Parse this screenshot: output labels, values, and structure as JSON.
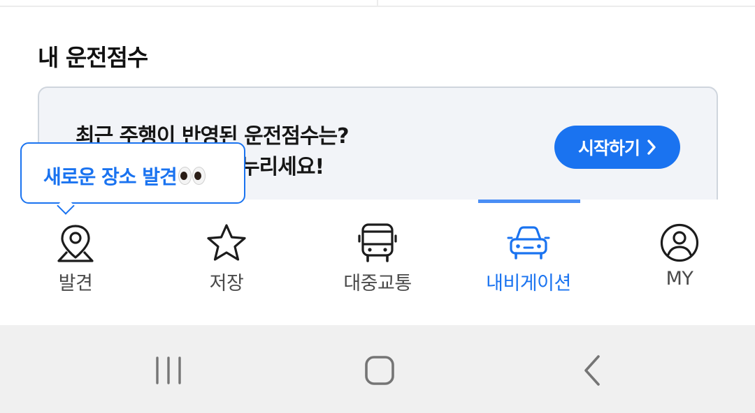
{
  "section": {
    "title": "내 운전점수"
  },
  "score_card": {
    "line1": "최근 주행이 반영된 운전점수는?",
    "line2_prefix": "",
    "line2_suffix": "택 누리세요!",
    "button_label": "시작하기"
  },
  "tooltip": {
    "text": "새로운 장소 발견"
  },
  "tabs": [
    {
      "label": "발견",
      "icon": "map-pin-icon",
      "active": false
    },
    {
      "label": "저장",
      "icon": "star-icon",
      "active": false
    },
    {
      "label": "대중교통",
      "icon": "bus-icon",
      "active": false
    },
    {
      "label": "내비게이션",
      "icon": "car-icon",
      "active": true
    },
    {
      "label": "MY",
      "icon": "user-circle-icon",
      "active": false
    }
  ],
  "system_nav": {
    "icons": [
      "recent-apps-icon",
      "home-icon",
      "back-icon"
    ]
  },
  "colors": {
    "accent": "#1a73f0",
    "card_bg": "#f2f4f8",
    "nav_bg": "#f0f0f0"
  }
}
